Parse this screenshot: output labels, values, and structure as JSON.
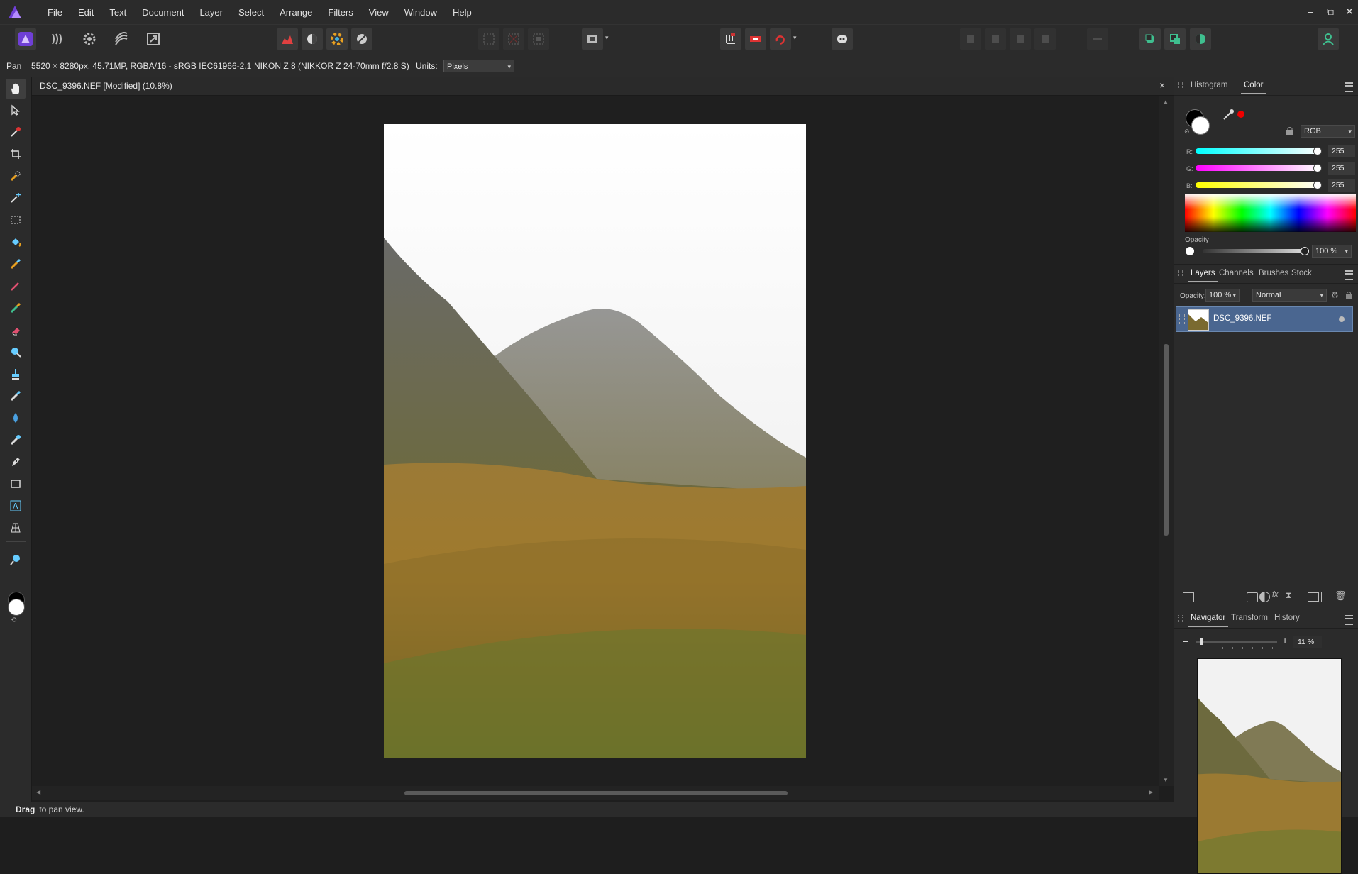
{
  "menubar": {
    "items": [
      "File",
      "Edit",
      "Text",
      "Document",
      "Layer",
      "Select",
      "Arrange",
      "Filters",
      "View",
      "Window",
      "Help"
    ],
    "window_controls": [
      "–",
      "⧉",
      "✕"
    ]
  },
  "context": {
    "tool_name": "Pan",
    "doc_info": "5520 × 8280px, 45.71MP, RGBA/16 - sRGB IEC61966-2.1",
    "camera_info": "NIKON Z 8 (NIKKOR Z 24-70mm f/2.8 S)",
    "units_label": "Units:",
    "units_value": "Pixels"
  },
  "document": {
    "title": "DSC_9396.NEF [Modified] (10.8%)",
    "close": "×"
  },
  "status": {
    "bold": "Drag",
    "rest": " to pan view."
  },
  "color_panel": {
    "tabs": [
      "Histogram",
      "Color"
    ],
    "selected_tab": "Color",
    "mode": "RGB",
    "channels": [
      {
        "label": "R:",
        "value": "255"
      },
      {
        "label": "G:",
        "value": "255"
      },
      {
        "label": "B:",
        "value": "255"
      }
    ],
    "opacity_label": "Opacity",
    "opacity_value": "100 %"
  },
  "layers_panel": {
    "tabs": [
      "Layers",
      "Channels",
      "Brushes",
      "Stock"
    ],
    "selected_tab": "Layers",
    "opacity_label": "Opacity:",
    "opacity_value": "100 %",
    "blend_mode": "Normal",
    "layers": [
      {
        "name": "DSC_9396.NEF"
      }
    ]
  },
  "navigator_panel": {
    "tabs": [
      "Navigator",
      "Transform",
      "History"
    ],
    "selected_tab": "Navigator",
    "zoom_value": "11 %",
    "zoom_level": 0.05
  },
  "colors": {
    "accent": "#7c4dff",
    "selected_layer": "#4a6690",
    "teal_icon": "#3fbf8f",
    "primary_swatch": "#000000",
    "secondary_swatch": "#ffffff"
  }
}
